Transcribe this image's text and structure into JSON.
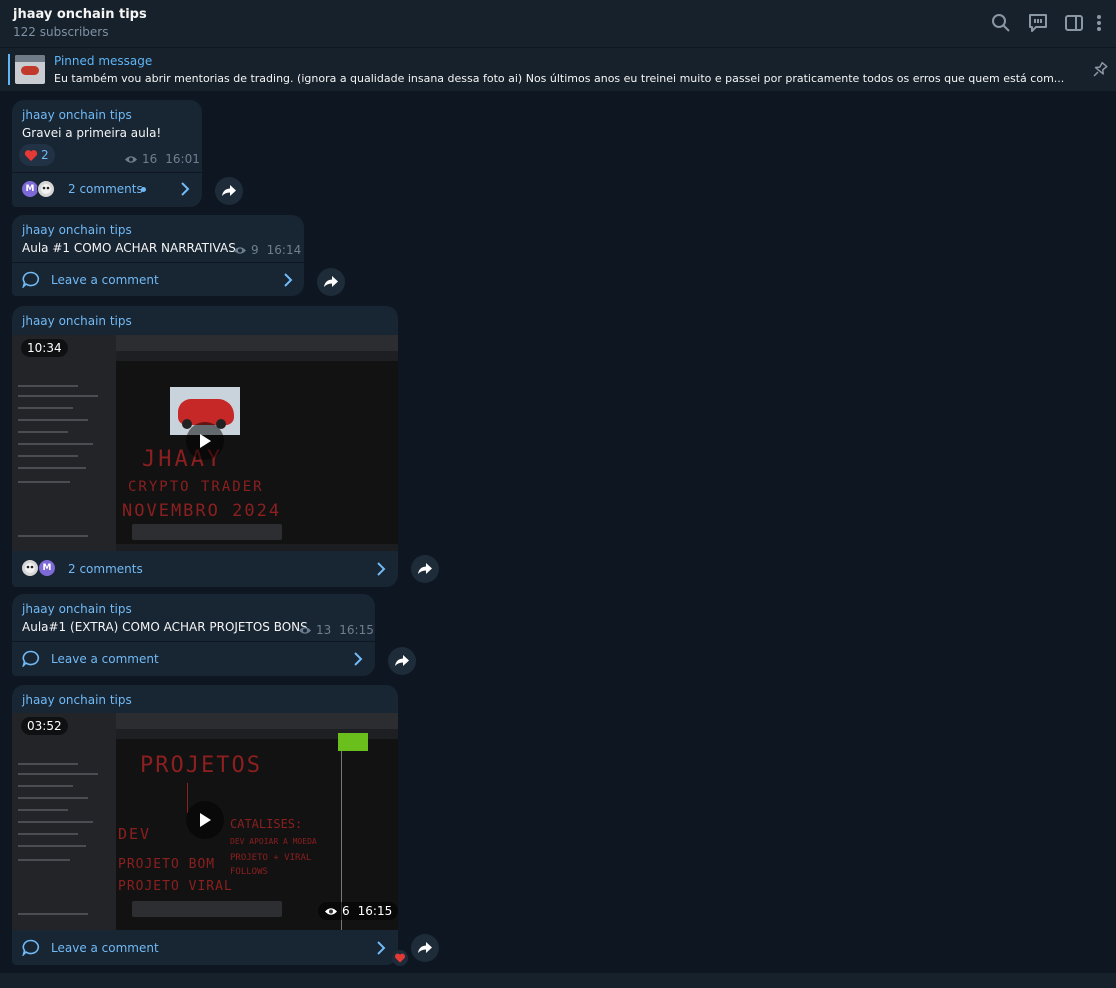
{
  "header": {
    "title": "jhaay onchain tips",
    "subtitle": "122 subscribers"
  },
  "icons": {
    "search": "search-icon",
    "discuss": "discuss-icon",
    "sidebar": "sidebar-toggle-icon",
    "more": "more-vertical-icon",
    "pin": "unpin-icon",
    "eye": "eye-icon",
    "share": "share-icon",
    "comment": "comment-icon",
    "chevron": "chevron-right-icon",
    "play": "play-icon",
    "heart": "heart-icon"
  },
  "colors": {
    "background": "#0e1621",
    "panel": "#17212b",
    "bubble": "#182533",
    "accent": "#71baf5",
    "muted": "#6d7f8f"
  },
  "pinned": {
    "label": "Pinned message",
    "text": "Eu também vou abrir mentorias de trading. (ignora a qualidade insana dessa foto ai)  Nos últimos anos eu treinei muito e passei por praticamente todos os erros que quem está com..."
  },
  "messages": [
    {
      "author": "jhaay onchain tips",
      "text": "Gravei a primeira aula!",
      "reaction_count": "2",
      "views": "16",
      "time": "16:01",
      "comments_label": "2 comments",
      "avatar_letter": "M"
    },
    {
      "author": "jhaay onchain tips",
      "text": "Aula #1 COMO ACHAR NARRATIVAS",
      "views": "9",
      "time": "16:14",
      "comments_label": "Leave a comment"
    },
    {
      "author": "jhaay onchain tips",
      "duration": "10:34",
      "comments_label": "2 comments",
      "avatar_letter": "M",
      "video_text": [
        "JHAAY",
        "CRYPTO TRADER",
        "NOVEMBRO 2024"
      ]
    },
    {
      "author": "jhaay onchain tips",
      "text": "Aula#1 (EXTRA) COMO ACHAR PROJETOS BONS",
      "views": "13",
      "time": "16:15",
      "comments_label": "Leave a comment"
    },
    {
      "author": "jhaay onchain tips",
      "duration": "03:52",
      "views": "6",
      "time": "16:15",
      "comments_label": "Leave a comment",
      "video_text": [
        "PROJETOS",
        "DEV",
        "PROJETO BOM",
        "PROJETO VIRAL",
        "CATALISES:",
        "DEV APOIAR A MOEDA",
        "PROJETO + VIRAL",
        "FOLLOWS"
      ]
    }
  ]
}
